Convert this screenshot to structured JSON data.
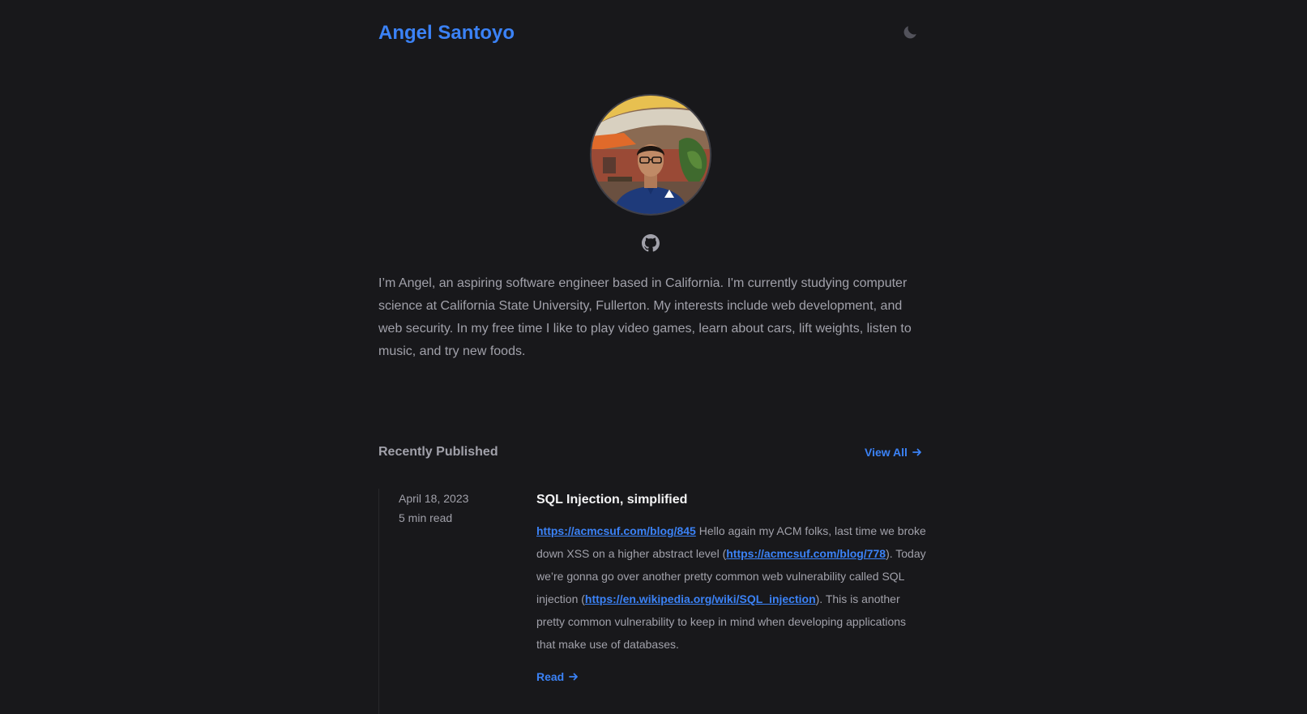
{
  "header": {
    "site_title": "Angel Santoyo",
    "theme_toggle_icon": "moon-icon"
  },
  "profile": {
    "avatar_icon": "profile-photo",
    "github_icon": "github-icon",
    "bio": "I’m Angel, an aspiring software engineer based in California. I'm currently studying computer science at California State University, Fullerton. My interests include web development, and web security. In my free time I like to play video games, learn about cars, lift weights, listen to music, and try new foods."
  },
  "recent": {
    "section_title": "Recently Published",
    "view_all_label": "View All",
    "arrow_icon": "arrow-right-icon"
  },
  "posts": [
    {
      "date": "April 18, 2023",
      "read_time": "5 min read",
      "title": "SQL Injection, simplified",
      "excerpt": {
        "link1": "https://acmcsuf.com/blog/845",
        "text1": " Hello again my ACM folks, last time we broke down XSS on a higher abstract level (",
        "link2": "https://acmcsuf.com/blog/778",
        "text2": "). Today we’re gonna go over another pretty common web vulnerability called SQL injection (",
        "link3": "https://en.wikipedia.org/wiki/SQL_injection",
        "text3": "). This is another pretty common vulnerability to keep in mind when developing applications that make use of databases."
      },
      "read_label": "Read"
    }
  ],
  "colors": {
    "background": "#18181b",
    "accent": "#3b82f6",
    "muted_text": "#a1a1aa",
    "heading_text": "#f4f4f5"
  }
}
